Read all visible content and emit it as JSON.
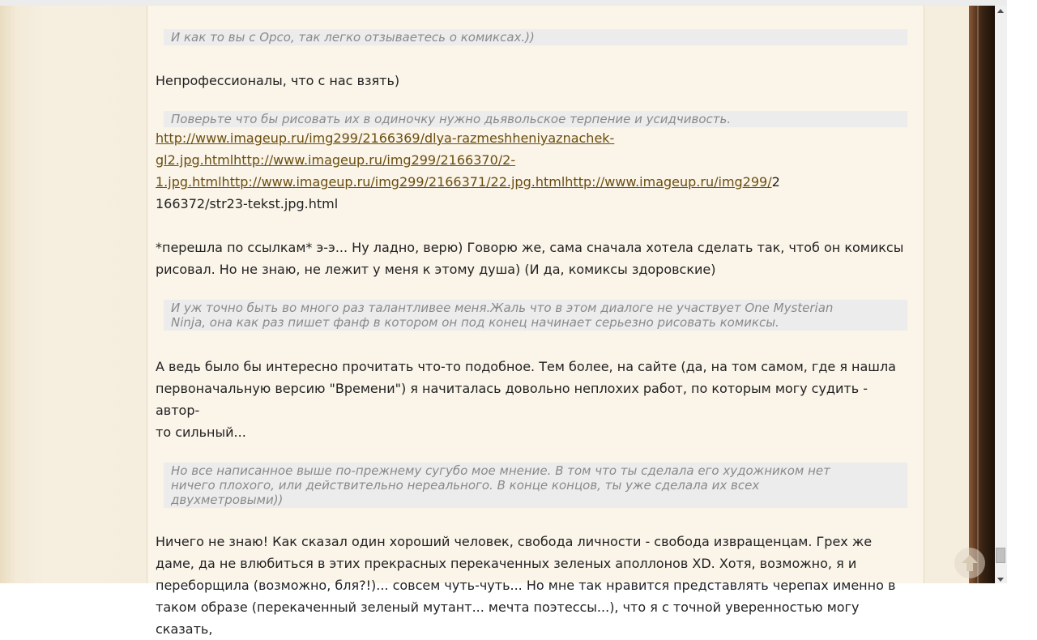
{
  "colors": {
    "quote_bg": "#ececec",
    "quote_text": "#8a8a8a",
    "reply_text": "#222222",
    "link": "#6a4e0f",
    "post_bg": "#faf4e9",
    "frame": "#3a2414"
  },
  "post": {
    "quote1": "И как то вы с Орсо, так легко отзываетесь о комиксах.))",
    "reply1": "Непрофессионалы, что с нас взять)",
    "quote2": "Поверьте что бы рисовать их в одиночку нужно дьявольское терпение и усидчивость.",
    "links": {
      "line1": "http://www.imageup.ru/img299/2166369/dlya-razmeshheniyaznachek-",
      "line2": "gl2.jpg.htmlhttp://www.imageup.ru/img299/2166370/2-",
      "line3_link": "1.jpg.htmlhttp://www.imageup.ru/img299/2166371/22.jpg.htmlhttp://www.imageup.ru/img299/",
      "line3_text": "2",
      "line4": "166372/str23-tekst.jpg.html"
    },
    "reply2_line1": "*перешла по ссылкам* э-э... Ну ладно, верю) Говорю же, сама сначала хотела сделать так, чтоб он комиксы",
    "reply2_line2": "рисовал. Но не знаю, не лежит у меня к этому душа) (И да, комиксы здоровские)",
    "quote3_line1": "И уж точно быть во много раз талантливее меня.Жаль что в этом диалоге не участвует One Mysterian",
    "quote3_line2": "Ninja, она как раз пишет фанф в котором он под конец начинает серьезно рисовать комиксы.",
    "reply3_line1": "А ведь было бы интересно прочитать что-то подобное. Тем более, на сайте (да, на том самом, где я нашла",
    "reply3_line2": "первоначальную версию \"Времени\") я начиталась довольно неплохих работ, по которым могу судить - автор-",
    "reply3_line3": "то сильный...",
    "quote4_line1": "Но все написанное выше по-прежнему сугубо мое мнение. В том что ты сделала его художником нет",
    "quote4_line2": "ничего плохого, или действительно нереального. В конце концов, ты уже сделала их всех",
    "quote4_line3": "двухметровыми))",
    "reply4_line1": "Ничего не знаю! Как сказал один хороший человек, свобода личности - свобода извращенцам. Грех же",
    "reply4_line2": "даме, да не влюбиться в этих прекрасных перекаченных зеленых аполлонов XD. Хотя, возможно, я и",
    "reply4_line3": "переборщила (возможно, бля?!)... совсем чуть-чуть... Но мне так нравится представлять черепах именно в",
    "reply4_line4": "таком образе (перекаченный зеленый мутант... мечта поэтессы...), что я с точной уверенностью могу сказать,"
  },
  "icons": {
    "scroll_up": "arrow-up-icon"
  }
}
